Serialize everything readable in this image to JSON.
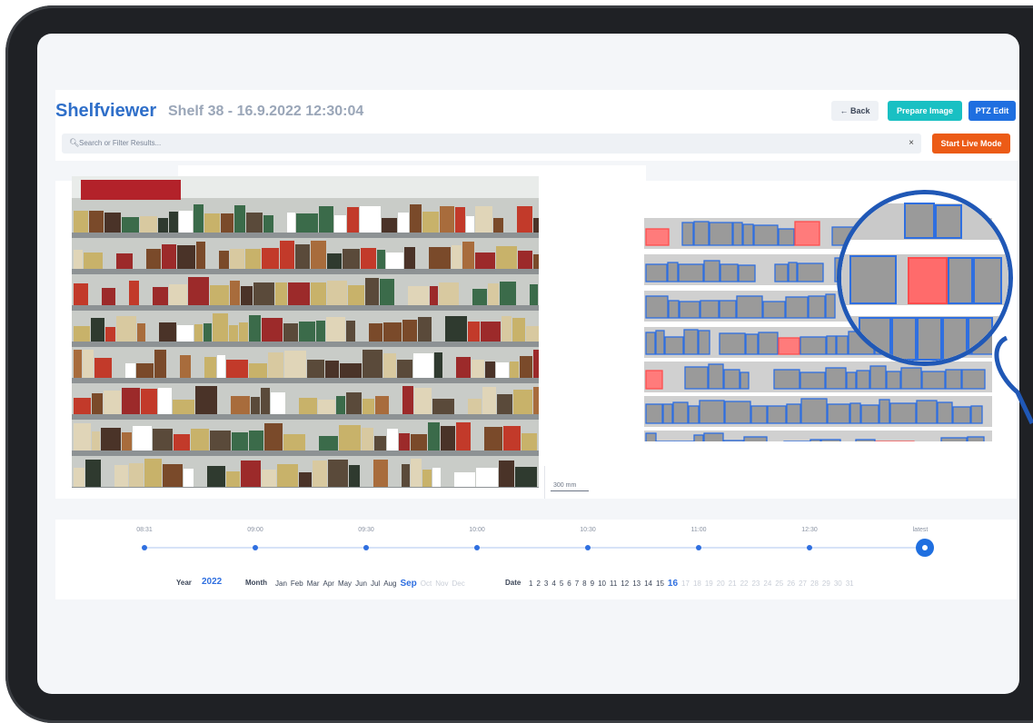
{
  "app": {
    "title": "Shelfviewer",
    "subtitle": "Shelf 38 - 16.9.2022 12:30:04"
  },
  "toolbar": {
    "back_label": "← Back",
    "prepare_label": "Prepare Image",
    "ptz_label": "PTZ Edit",
    "live_label": "Start Live Mode"
  },
  "search": {
    "placeholder": "Search or Filter Results...",
    "clear_icon": "close-icon"
  },
  "scale": {
    "label": "300 mm"
  },
  "timeline": {
    "times": [
      "08:31",
      "09:00",
      "09:30",
      "10:00",
      "10:30",
      "11:00",
      "12:30",
      "latest"
    ],
    "year_label": "Year",
    "year_value": "2022",
    "month_label": "Month",
    "months": [
      "Jan",
      "Feb",
      "Mar",
      "Apr",
      "May",
      "Jun",
      "Jul",
      "Aug",
      "Sep",
      "Oct",
      "Nov",
      "Dec"
    ],
    "selected_month": "Sep",
    "date_label": "Date",
    "dates": [
      "1",
      "2",
      "3",
      "4",
      "5",
      "6",
      "7",
      "8",
      "9",
      "10",
      "11",
      "12",
      "13",
      "14",
      "15",
      "16",
      "17",
      "18",
      "19",
      "20",
      "21",
      "22",
      "23",
      "24",
      "25",
      "26",
      "27",
      "28",
      "29",
      "30",
      "31"
    ],
    "selected_date": "16"
  },
  "colors": {
    "brand": "#2f6fc9",
    "accent_teal": "#19c0c3",
    "accent_blue": "#1f6fe0",
    "live_orange": "#ec5b16",
    "planogram_ok": "#2f6fe0",
    "planogram_gap": "#ff4d4d"
  }
}
